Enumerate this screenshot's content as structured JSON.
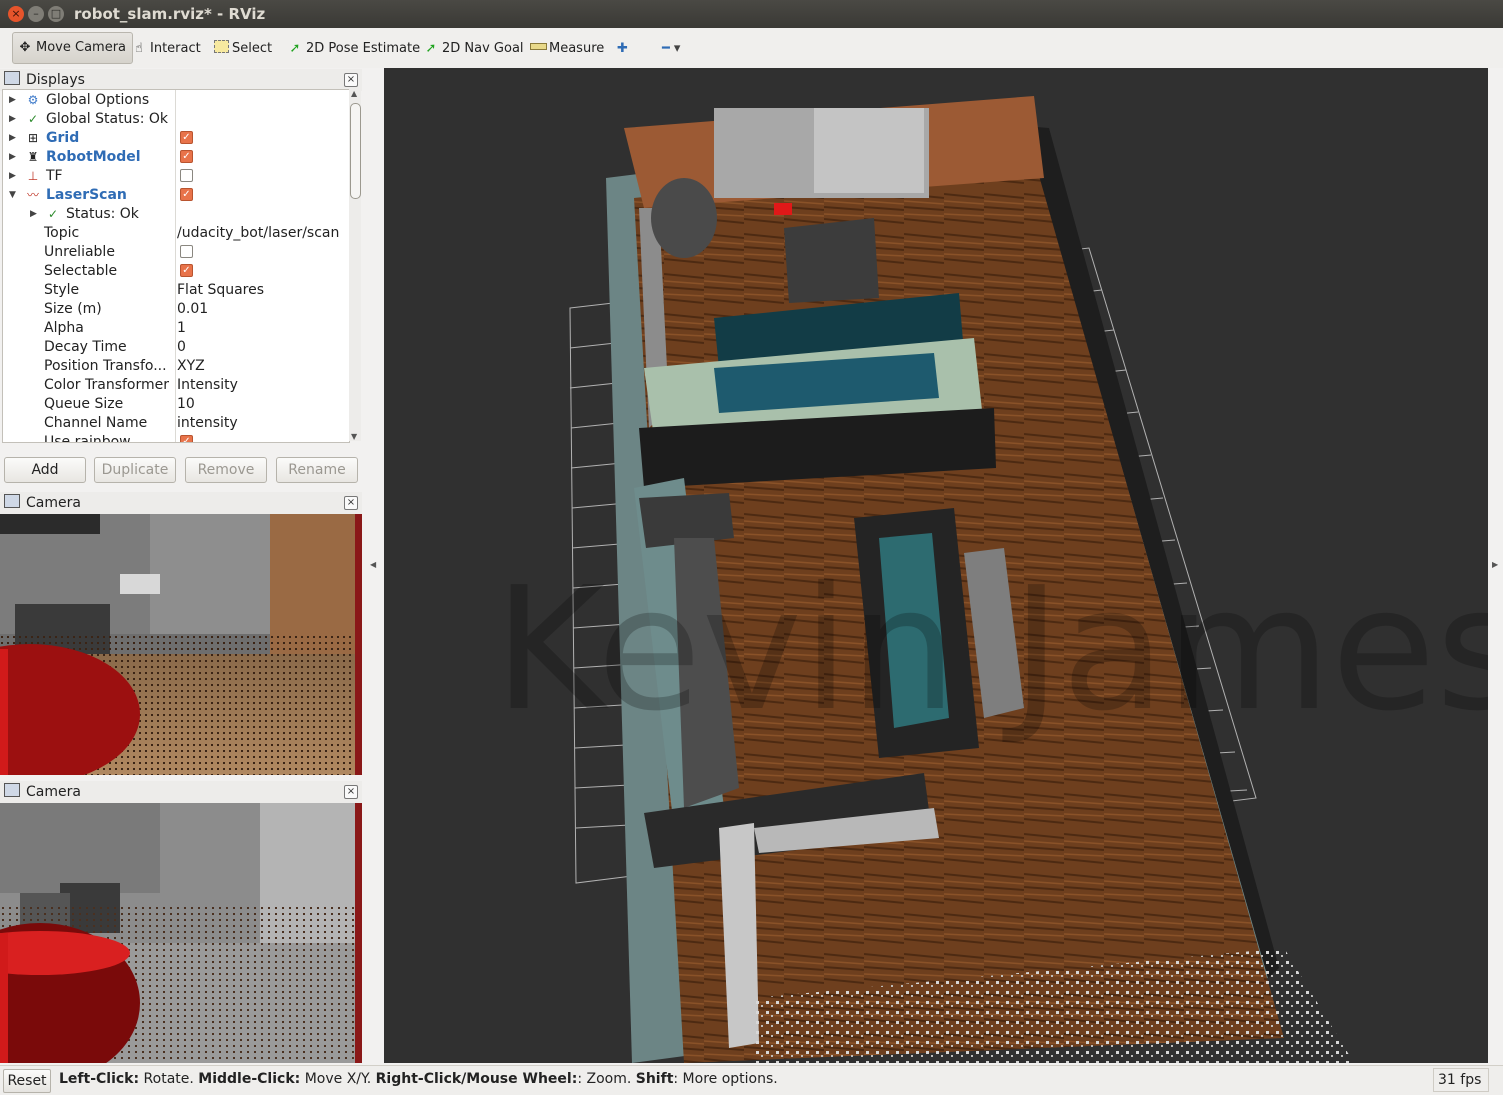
{
  "window": {
    "title": "robot_slam.rviz* - RViz",
    "close_glyph": "×",
    "min_glyph": "–",
    "max_glyph": "□"
  },
  "toolbar": {
    "move_camera": "Move Camera",
    "interact": "Interact",
    "select": "Select",
    "pose_estimate": "2D Pose Estimate",
    "nav_goal": "2D Nav Goal",
    "measure": "Measure",
    "add_glyph": "✚",
    "remove_glyph": "━",
    "dropdown_glyph": "▾"
  },
  "displays_panel": {
    "title": "Displays",
    "rows": [
      {
        "label": "Global Options",
        "value": ""
      },
      {
        "label": "Global Status: Ok",
        "value": ""
      },
      {
        "label": "Grid",
        "checked": true
      },
      {
        "label": "RobotModel",
        "checked": true
      },
      {
        "label": "TF",
        "checked": false
      },
      {
        "label": "LaserScan",
        "checked": true
      },
      {
        "label": "Status: Ok",
        "value": ""
      },
      {
        "label": "Topic",
        "value": "/udacity_bot/laser/scan"
      },
      {
        "label": "Unreliable",
        "checked": false
      },
      {
        "label": "Selectable",
        "checked": true
      },
      {
        "label": "Style",
        "value": "Flat Squares"
      },
      {
        "label": "Size (m)",
        "value": "0.01"
      },
      {
        "label": "Alpha",
        "value": "1"
      },
      {
        "label": "Decay Time",
        "value": "0"
      },
      {
        "label": "Position Transfo...",
        "value": "XYZ"
      },
      {
        "label": "Color Transformer",
        "value": "Intensity"
      },
      {
        "label": "Queue Size",
        "value": "10"
      },
      {
        "label": "Channel Name",
        "value": "intensity"
      },
      {
        "label": "Use rainbow",
        "checked": true
      }
    ],
    "buttons": {
      "add": "Add",
      "duplicate": "Duplicate",
      "remove": "Remove",
      "rename": "Rename"
    }
  },
  "camera_panels": [
    {
      "title": "Camera"
    },
    {
      "title": "Camera"
    }
  ],
  "viewport": {
    "watermark": "Kevin James"
  },
  "statusbar": {
    "reset": "Reset",
    "hint_parts": [
      {
        "text": "Left-Click:",
        "bold": true
      },
      {
        "text": " Rotate. ",
        "bold": false
      },
      {
        "text": "Middle-Click:",
        "bold": true
      },
      {
        "text": " Move X/Y. ",
        "bold": false
      },
      {
        "text": "Right-Click/Mouse Wheel:",
        "bold": true
      },
      {
        "text": ": Zoom. ",
        "bold": false
      },
      {
        "text": "Shift",
        "bold": true
      },
      {
        "text": ": More options.",
        "bold": false
      }
    ],
    "fps": "31 fps"
  },
  "colors": {
    "viewport_bg": "#303030",
    "floor": "#7a4a26",
    "grid": "#c8c8c8",
    "accent_orange": "#e8734a",
    "link_blue": "#2f6cb5"
  }
}
